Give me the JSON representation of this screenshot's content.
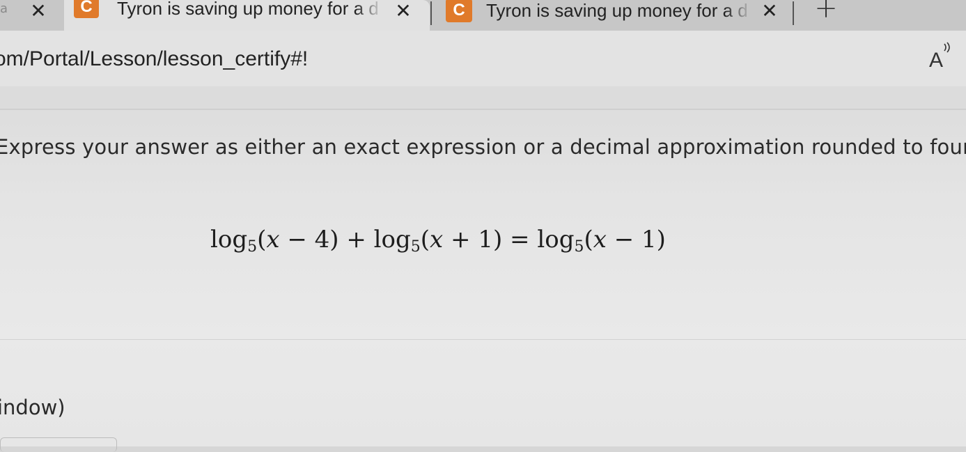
{
  "tabs": {
    "partial_fragment": "a",
    "items": [
      {
        "favicon": "C",
        "title": "Tyron is saving up money for a d"
      },
      {
        "favicon": "C",
        "title": "Tyron is saving up money for a d"
      }
    ],
    "close_glyph": "✕",
    "new_tab_glyph": "+"
  },
  "address_bar": {
    "url": "om/Portal/Lesson/lesson_certify#!",
    "read_aloud_icon": "read-aloud-icon",
    "read_aloud_text": "A"
  },
  "content": {
    "instruction": "Express your answer as either an exact expression or a decimal approximation rounded to four de",
    "equation": {
      "terms": [
        {
          "fn": "log",
          "base": "5",
          "arg": "(x − 4)"
        },
        {
          "op": " + "
        },
        {
          "fn": "log",
          "base": "5",
          "arg": "(x + 1)"
        },
        {
          "op": " = "
        },
        {
          "fn": "log",
          "base": "5",
          "arg": "(x − 1)"
        }
      ]
    },
    "window_fragment": "indow)"
  },
  "colors": {
    "favicon": "#e07a2a",
    "tabstrip": "#c7c7c7",
    "active_tab": "#e1e1e1"
  }
}
